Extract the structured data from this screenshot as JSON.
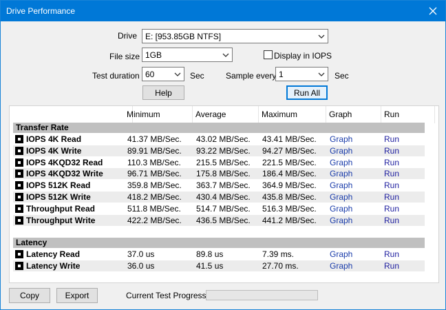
{
  "window": {
    "title": "Drive Performance"
  },
  "controls": {
    "drive_label": "Drive",
    "drive_value": "E: [953.85GB NTFS]",
    "file_size_label": "File size",
    "file_size_value": "1GB",
    "display_iops_label": "Display in IOPS",
    "display_iops_checked": false,
    "test_duration_label": "Test duration",
    "test_duration_value": "60",
    "test_duration_unit": "Sec",
    "sample_every_label": "Sample every",
    "sample_every_value": "1",
    "sample_every_unit": "Sec",
    "help_label": "Help",
    "run_all_label": "Run All"
  },
  "table": {
    "headers": [
      "",
      "Minimum",
      "Average",
      "Maximum",
      "Graph",
      "Run"
    ],
    "transfer_section": "Transfer Rate",
    "transfer_rows": [
      {
        "name": "IOPS 4K Read",
        "min": "41.37 MB/Sec.",
        "avg": "43.02 MB/Sec.",
        "max": "43.41 MB/Sec.",
        "graph": "Graph",
        "run": "Run"
      },
      {
        "name": "IOPS 4K Write",
        "min": "89.91 MB/Sec.",
        "avg": "93.22 MB/Sec.",
        "max": "94.27 MB/Sec.",
        "graph": "Graph",
        "run": "Run"
      },
      {
        "name": "IOPS 4KQD32 Read",
        "min": "110.3 MB/Sec.",
        "avg": "215.5 MB/Sec.",
        "max": "221.5 MB/Sec.",
        "graph": "Graph",
        "run": "Run"
      },
      {
        "name": "IOPS 4KQD32 Write",
        "min": "96.71 MB/Sec.",
        "avg": "175.8 MB/Sec.",
        "max": "186.4 MB/Sec.",
        "graph": "Graph",
        "run": "Run"
      },
      {
        "name": "IOPS 512K Read",
        "min": "359.8 MB/Sec.",
        "avg": "363.7 MB/Sec.",
        "max": "364.9 MB/Sec.",
        "graph": "Graph",
        "run": "Run"
      },
      {
        "name": "IOPS 512K Write",
        "min": "418.2 MB/Sec.",
        "avg": "430.4 MB/Sec.",
        "max": "435.8 MB/Sec.",
        "graph": "Graph",
        "run": "Run"
      },
      {
        "name": "Throughput Read",
        "min": "511.8 MB/Sec.",
        "avg": "514.7 MB/Sec.",
        "max": "516.3 MB/Sec.",
        "graph": "Graph",
        "run": "Run"
      },
      {
        "name": "Throughput Write",
        "min": "422.2 MB/Sec.",
        "avg": "436.5 MB/Sec.",
        "max": "441.2 MB/Sec.",
        "graph": "Graph",
        "run": "Run"
      }
    ],
    "latency_section": "Latency",
    "latency_rows": [
      {
        "name": "Latency Read",
        "min": "37.0 us",
        "avg": "89.8 us",
        "max": "7.39 ms.",
        "graph": "Graph",
        "run": "Run"
      },
      {
        "name": "Latency Write",
        "min": "36.0 us",
        "avg": "41.5 us",
        "max": "27.70 ms.",
        "graph": "Graph",
        "run": "Run"
      }
    ]
  },
  "footer": {
    "copy_label": "Copy",
    "export_label": "Export",
    "progress_label": "Current Test Progress",
    "progress_value": 0
  },
  "icons": {
    "close": "close-icon",
    "dropdown": "chevron-down-icon",
    "row_icon": "test-item-icon"
  },
  "colors": {
    "titlebar": "#0078d7",
    "link": "#1a0dab",
    "section_bg": "#c0c0c0",
    "row_alt": "#ececec"
  }
}
